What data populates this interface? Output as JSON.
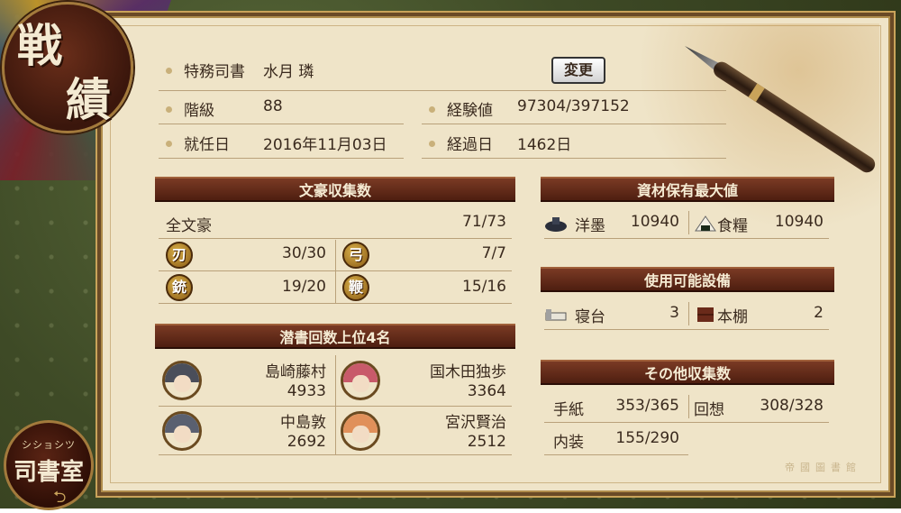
{
  "screen": {
    "title_char1": "戦",
    "title_char2": "績"
  },
  "profile": {
    "librarian_label": "特務司書",
    "librarian_name": "水月 璘",
    "change_button": "変更",
    "rank_label": "階級",
    "rank_value": "88",
    "exp_label": "経験値",
    "exp_value": "97304/397152",
    "appointed_label": "就任日",
    "appointed_value": "2016年11月03日",
    "elapsed_label": "経過日",
    "elapsed_value": "1462日"
  },
  "collection": {
    "header": "文豪収集数",
    "all_label": "全文豪",
    "all_value": "71/73",
    "weapons": [
      {
        "badge": "刃",
        "value": "30/30"
      },
      {
        "badge": "弓",
        "value": "7/7"
      },
      {
        "badge": "銃",
        "value": "19/20"
      },
      {
        "badge": "鞭",
        "value": "15/16"
      }
    ]
  },
  "dives": {
    "header": "潜書回数上位4名",
    "top": [
      {
        "name": "島崎藤村",
        "count": "4933",
        "hair": "#4a4e5a"
      },
      {
        "name": "国木田独歩",
        "count": "3364",
        "hair": "#c85a6a"
      },
      {
        "name": "中島敦",
        "count": "2692",
        "hair": "#5a6070"
      },
      {
        "name": "宮沢賢治",
        "count": "2512",
        "hair": "#e0905a"
      }
    ]
  },
  "materials": {
    "header": "資材保有最大値",
    "ink_label": "洋墨",
    "ink_value": "10940",
    "food_label": "食糧",
    "food_value": "10940"
  },
  "facilities": {
    "header": "使用可能設備",
    "bed_label": "寝台",
    "bed_value": "3",
    "shelf_label": "本棚",
    "shelf_value": "2"
  },
  "others": {
    "header": "その他収集数",
    "letters_label": "手紙",
    "letters_value": "353/365",
    "memories_label": "回想",
    "memories_value": "308/328",
    "decor_label": "内装",
    "decor_value": "155/290"
  },
  "library_button": {
    "ruby": "シショシツ",
    "label": "司書室"
  },
  "watermark": "帝國圖書館",
  "colors": {
    "header_brown": "#5e2a16",
    "paper": "#efe4c8",
    "gold": "#c9a35a"
  }
}
